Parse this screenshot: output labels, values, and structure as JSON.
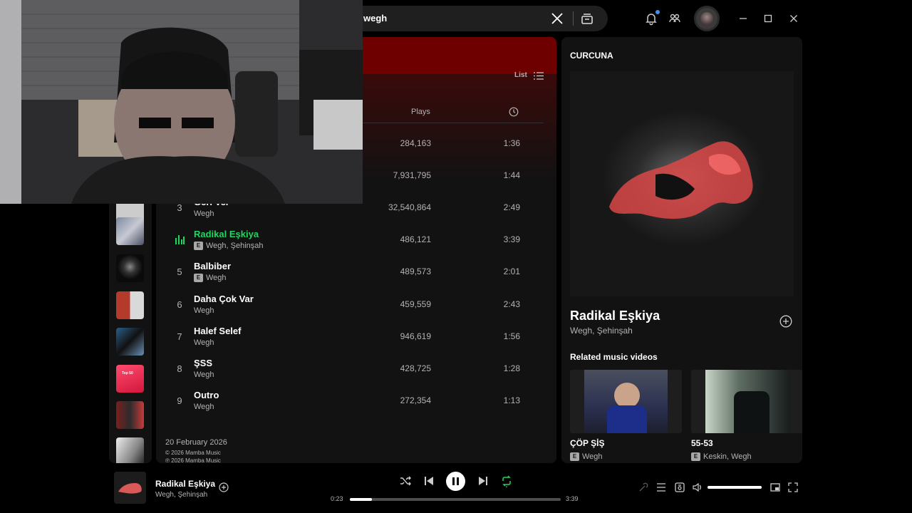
{
  "search": {
    "query": "wegh"
  },
  "main": {
    "view_toggle_label": "List",
    "columns": {
      "plays": "Plays"
    },
    "tracks": [
      {
        "num": "",
        "title": "",
        "artist": "",
        "explicit": false,
        "plays": "284,163",
        "duration": "1:36",
        "playing": false
      },
      {
        "num": "",
        "title": "",
        "artist": "",
        "explicit": false,
        "plays": "7,931,795",
        "duration": "1:44",
        "playing": false
      },
      {
        "num": "3",
        "title": "Geri Ver",
        "artist": "Wegh",
        "explicit": false,
        "plays": "32,540,864",
        "duration": "2:49",
        "playing": false
      },
      {
        "num": "",
        "title": "Radikal Eşkiya",
        "artist": "Wegh, Şehinşah",
        "explicit": true,
        "plays": "486,121",
        "duration": "3:39",
        "playing": true
      },
      {
        "num": "5",
        "title": "Balbiber",
        "artist": "Wegh",
        "explicit": true,
        "plays": "489,573",
        "duration": "2:01",
        "playing": false
      },
      {
        "num": "6",
        "title": "Daha Çok Var",
        "artist": "Wegh",
        "explicit": false,
        "plays": "459,559",
        "duration": "2:43",
        "playing": false
      },
      {
        "num": "7",
        "title": "Halef Selef",
        "artist": "Wegh",
        "explicit": false,
        "plays": "946,619",
        "duration": "1:56",
        "playing": false
      },
      {
        "num": "8",
        "title": "ŞSS",
        "artist": "Wegh",
        "explicit": false,
        "plays": "428,725",
        "duration": "1:28",
        "playing": false
      },
      {
        "num": "9",
        "title": "Outro",
        "artist": "Wegh",
        "explicit": false,
        "plays": "272,354",
        "duration": "1:13",
        "playing": false
      }
    ],
    "release_date": "20 February 2026",
    "copyright": [
      "© 2026 Mamba Music",
      "℗ 2026 Mamba Music"
    ]
  },
  "sidebar": {
    "top50_label": "Top 50"
  },
  "right_panel": {
    "title": "CURCUNA",
    "track_title": "Radikal Eşkiya",
    "track_artists": "Wegh, Şehinşah",
    "related_heading": "Related music videos",
    "videos": [
      {
        "title": "ÇÖP ŞİŞ",
        "artist": "Wegh",
        "explicit": true
      },
      {
        "title": "55-53",
        "artist": "Keskin, Wegh",
        "explicit": true
      }
    ]
  },
  "player": {
    "title": "Radikal Eşkiya",
    "artist": "Wegh, Şehinşah",
    "elapsed": "0:23",
    "total": "3:39",
    "progress": 0.105,
    "volume": 1.0,
    "shuffle": false,
    "repeat": true
  },
  "explicit_badge": "E",
  "colors": {
    "accent": "#1ed760",
    "banner": "#6e0000",
    "panel": "#121212"
  },
  "icons": [
    "close-icon",
    "browse-icon",
    "bell-icon",
    "friends-icon",
    "list-view-icon",
    "clock-icon",
    "equalizer-icon",
    "add-circle-icon",
    "shuffle-icon",
    "previous-icon",
    "pause-icon",
    "next-icon",
    "repeat-icon",
    "lyrics-icon",
    "queue-icon",
    "connect-device-icon",
    "volume-icon",
    "miniplayer-icon",
    "fullscreen-icon",
    "minimize-icon",
    "maximize-icon"
  ]
}
